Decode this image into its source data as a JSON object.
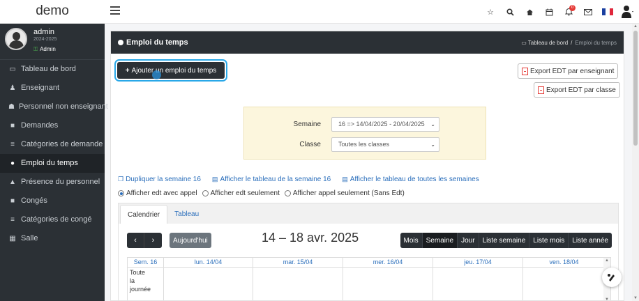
{
  "brand": "demo",
  "user": {
    "name": "admin",
    "year": "2024-2025",
    "role": "Admin"
  },
  "sidebar": {
    "items": [
      {
        "label": "Tableau de bord",
        "icon": "monitor-icon"
      },
      {
        "label": "Enseignant",
        "icon": "teacher-icon"
      },
      {
        "label": "Personnel non enseignant",
        "icon": "staff-icon"
      },
      {
        "label": "Demandes",
        "icon": "briefcase-icon"
      },
      {
        "label": "Catégories de demande",
        "icon": "list-icon"
      },
      {
        "label": "Emploi du temps",
        "icon": "circle-icon",
        "active": true
      },
      {
        "label": "Présence du personnel",
        "icon": "presence-icon"
      },
      {
        "label": "Congés",
        "icon": "briefcase-icon"
      },
      {
        "label": "Catégories de congé",
        "icon": "list-icon"
      },
      {
        "label": "Salle",
        "icon": "grid-icon"
      }
    ]
  },
  "topbar": {
    "icons": [
      "star-icon",
      "search-icon",
      "home-icon",
      "calendar-icon",
      "bell-icon",
      "mail-icon",
      "flag-fr-icon",
      "user-menu-icon"
    ],
    "notification_count": "0"
  },
  "page": {
    "title": "Emploi du temps",
    "breadcrumb": {
      "home": "Tableau de bord",
      "separator": "/",
      "current": "Emploi du temps"
    },
    "add_button": "Ajouter un emploi du temps",
    "export_teacher": "Export EDT par enseignant",
    "export_class": "Export EDT par classe"
  },
  "filter": {
    "week_label": "Semaine",
    "week_value": "16 => 14/04/2025 - 20/04/2025",
    "class_label": "Classe",
    "class_value": "Toutes les classes"
  },
  "links": {
    "duplicate": "Dupliquer la semaine 16",
    "show_week": "Afficher le tableau de la semaine 16",
    "show_all": "Afficher le tableau de toutes les semaines"
  },
  "radios": [
    {
      "label": "Afficher edt avec appel",
      "checked": true
    },
    {
      "label": "Afficher edt seulement",
      "checked": false
    },
    {
      "label": "Afficher appel seulement (Sans Edt)",
      "checked": false
    }
  ],
  "tabs": [
    {
      "label": "Calendrier",
      "active": true
    },
    {
      "label": "Tableau",
      "active": false
    }
  ],
  "calendar": {
    "prev": "‹",
    "next": "›",
    "today": "Aujourd'hui",
    "title": "14 – 18 avr. 2025",
    "views": [
      {
        "label": "Mois",
        "active": false
      },
      {
        "label": "Semaine",
        "active": true
      },
      {
        "label": "Jour",
        "active": false
      },
      {
        "label": "Liste semaine",
        "active": false
      },
      {
        "label": "Liste mois",
        "active": false
      },
      {
        "label": "Liste année",
        "active": false
      }
    ],
    "week_col": "Sem. 16",
    "days": [
      "lun. 14/04",
      "mar. 15/04",
      "mer. 16/04",
      "jeu. 17/04",
      "ven. 18/04"
    ],
    "allday_label": "Toute la journée"
  },
  "colors": {
    "dark": "#2b3035",
    "link": "#2a6ebb",
    "filter_bg": "#fcf6dd",
    "focus_ring": "#29a8e8",
    "pdf_red": "#e53935"
  }
}
